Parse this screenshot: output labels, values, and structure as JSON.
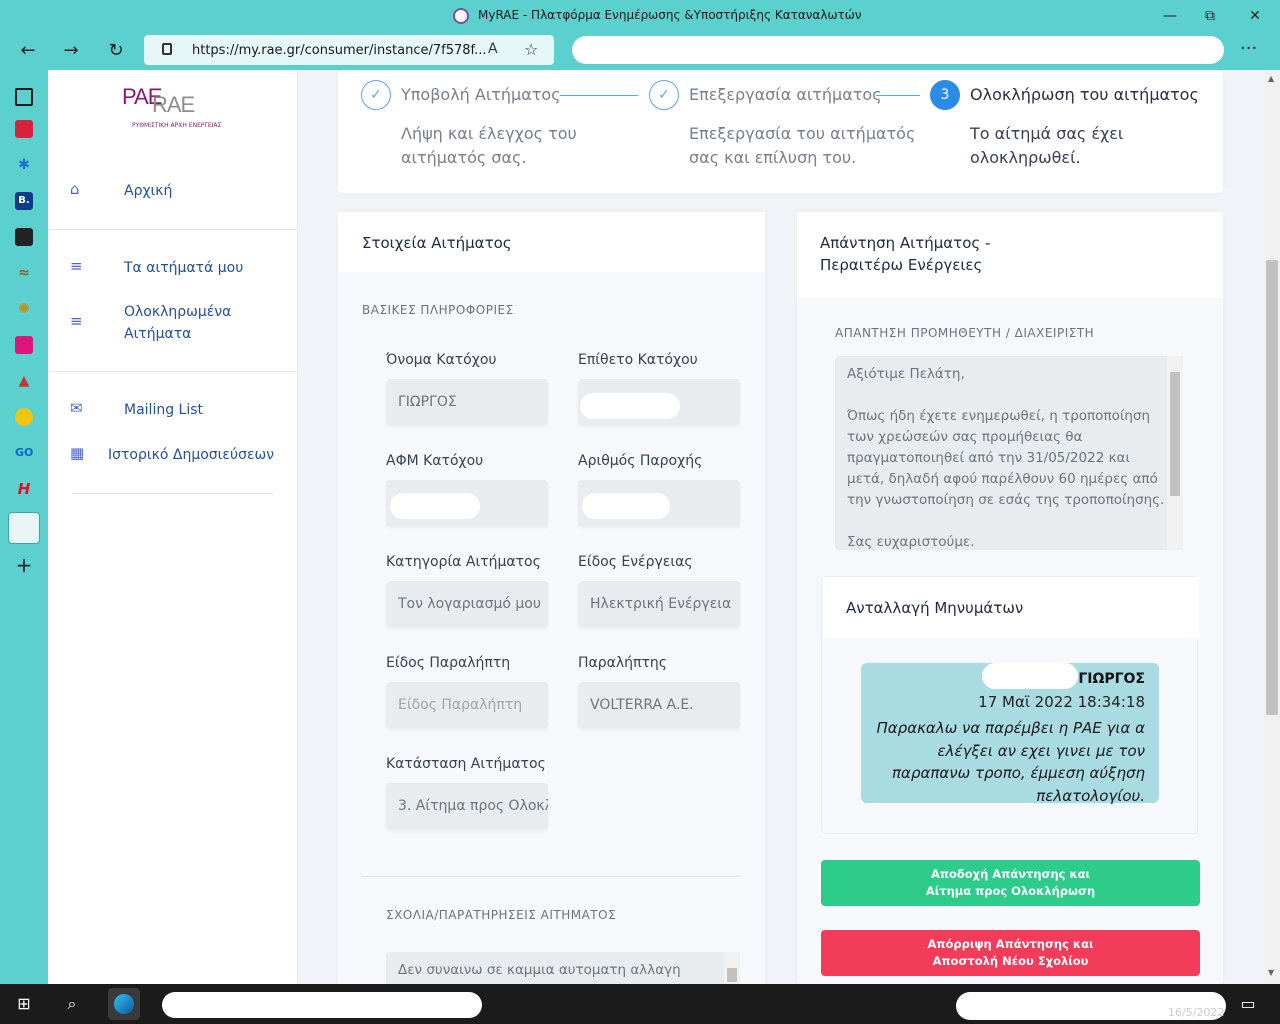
{
  "browser": {
    "window_title": "MyRAE - Πλατφόρμα Ενημέρωσης &Υποστήριξης Καταναλωτών",
    "url": "https://my.rae.gr/consumer/instance/7f578f...",
    "minimize_glyph": "—",
    "maximize_glyph": "⧉",
    "close_glyph": "✕",
    "back_glyph": "←",
    "forward_glyph": "→",
    "refresh_glyph": "↻",
    "read_aloud_glyph": "A",
    "favorite_glyph": "☆",
    "more_glyph": "···"
  },
  "edge_sidebar": {
    "icons": [
      "tabs-icon",
      "red-app-icon",
      "bloom-icon",
      "booking-icon",
      "doc-icon",
      "tool-icon",
      "wheel-icon",
      "chart-icon",
      "triangle-icon",
      "yellow-circle-icon",
      "go-icon",
      "h-icon",
      "myrae-icon"
    ],
    "go_label": "GO",
    "h_label": "H",
    "b_label": "B.",
    "add_glyph": "+"
  },
  "logo": {
    "pae": "PAE",
    "rae": "RAE",
    "subtitle": "ΡΥΘΜΙΣΤΙΚΗ ΑΡΧΗ ΕΝΕΡΓΕΙΑΣ"
  },
  "sidebar": {
    "home": "Αρχική",
    "my_requests": "Τα αιτήματά μου",
    "completed_requests_1": "Ολοκληρωμένα",
    "completed_requests_2": "Αιτήματα",
    "mailing_list": "Mailing List",
    "publication_history": "Ιστορικό Δημοσιεύσεων"
  },
  "stepper": {
    "steps": [
      {
        "title": "Υποβολή Αιτήματος",
        "desc_1": "Λήψη και έλεγχος του",
        "desc_2": "αιτήματός σας.",
        "marker": "✓"
      },
      {
        "title": "Επεξεργασία αιτήματος",
        "desc_1": "Επεξεργασία του αιτήματός",
        "desc_2": "σας και επίλυση του.",
        "marker": "✓"
      },
      {
        "title": "Ολοκλήρωση του αιτήματος",
        "desc_1": "Το αίτημά σας έχει",
        "desc_2": "ολοκληρωθεί.",
        "marker": "3"
      }
    ]
  },
  "details": {
    "heading": "Στοιχεία Αιτήματος",
    "basic_info": "ΒΑΣΙΚΕΣ ΠΛΗΡΟΦΟΡΙΕΣ",
    "owner_name_label": "Όνομα Κατόχου",
    "owner_name_value": "ΓΙΩΡΓΟΣ",
    "owner_surname_label": "Επίθετο Κατόχου",
    "afm_label": "ΑΦΜ Κατόχου",
    "supply_number_label": "Αριθμός Παροχής",
    "category_label": "Κατηγορία Αιτήματος",
    "category_value": "Τον λογαριασμό μου",
    "energy_type_label": "Είδος Ενέργειας",
    "energy_type_value": "Ηλεκτρική Ενέργεια",
    "recipient_type_label": "Είδος Παραλήπτη",
    "recipient_type_placeholder": "Είδος Παραλήπτη",
    "recipient_label": "Παραλήπτης",
    "recipient_value": "VOLTERRA A.E.",
    "status_label": "Κατάσταση Αιτήματος",
    "status_value": "3. Αίτημα προς Ολοκλ",
    "comments_label": "ΣΧΟΛΙΑ/ΠΑΡΑΤΗΡΗΣΕΙΣ ΑΙΤΗΜΑΤΟΣ",
    "comments_value": "Δεν συναινω σε καμμια αυτοματη αλλαγη"
  },
  "response": {
    "heading_1": "Απάντηση Αιτήματος -",
    "heading_2": "Περαιτέρω Ενέργειες",
    "supplier_label": "ΑΠΑΝΤΗΣΗ ΠΡΟΜΗΘΕΥΤΗ / ΔΙΑΧΕΙΡΙΣΤΗ",
    "supplier_lines": [
      "Αξιότιμε Πελάτη,",
      "",
      "Όπως ήδη έχετε ενημερωθεί, η τροποποίηση",
      "των χρεώσεών σας προμήθειας θα",
      "πραγματοποιηθεί από την 31/05/2022 και",
      "μετά, δηλαδή αφού παρέλθουν 60 ημέρες από",
      "την γνωστοποίηση σε εσάς της τροποποίησης.",
      "",
      "Σας ευχαριστούμε."
    ]
  },
  "messages": {
    "heading": "Ανταλλαγή Μηνυμάτων",
    "items": [
      {
        "sender": "ΓΙΩΡΓΟΣ",
        "time": "17 Μαϊ 2022 18:34:18",
        "text_lines": [
          "Παρακαλω να παρέμβει η ΡΑΕ για α",
          "ελέγξει αν εχει γινει με τον",
          "παραπανω τροπο, έμμεση αύξηση",
          "πελατολογίου."
        ]
      }
    ]
  },
  "actions": {
    "accept_1": "Αποδοχή Απάντησης και",
    "accept_2": "Αίτημα προς Ολοκλήρωση",
    "reject_1": "Απόρριψη Απάντησης και",
    "reject_2": "Αποστολή Νέου Σχολίου"
  },
  "taskbar": {
    "clock_partial": "16/5/2022"
  },
  "colors": {
    "edge_teal": "#5ccfcf",
    "accept": "#2ecc8a",
    "reject": "#f33b5a",
    "bubble": "#a8dbe2",
    "step_active": "#2d8be8"
  }
}
